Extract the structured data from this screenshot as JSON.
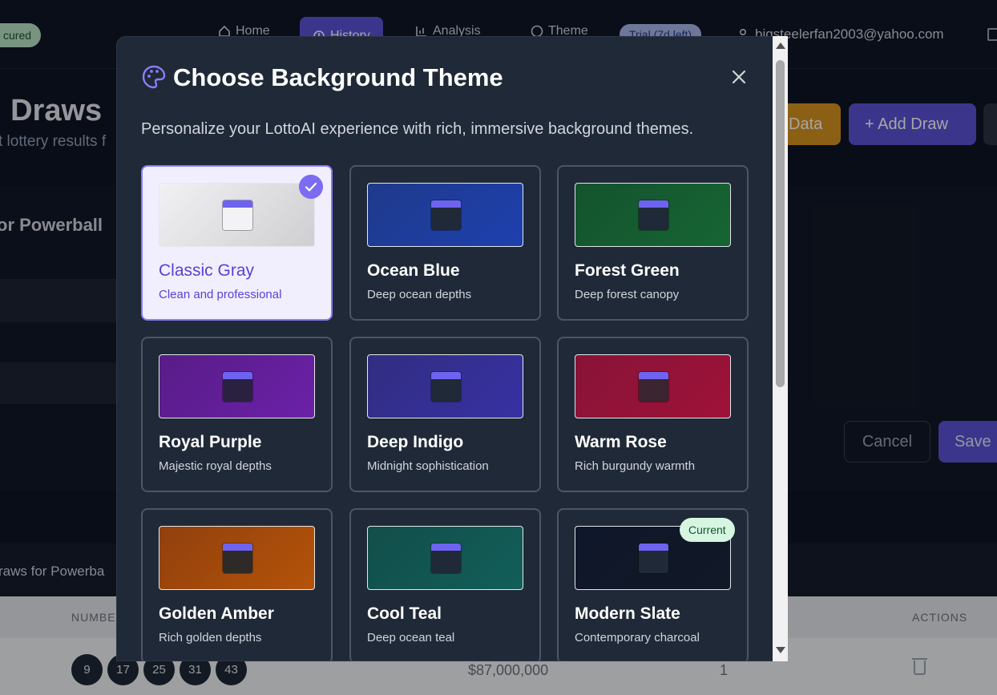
{
  "topnav": {
    "secured_label": "cured",
    "items": [
      {
        "label": "Home"
      },
      {
        "label": "History"
      },
      {
        "label": "Analysis"
      },
      {
        "label": "Theme"
      }
    ],
    "trial_label": "Trial (7d left)",
    "user_email": "bigsteelerfan2003@yahoo.com"
  },
  "page": {
    "title": "l Draws",
    "subtitle": "t lottery results f",
    "buttons": {
      "data_label": "Data",
      "add_draw_label": "+ Add Draw"
    },
    "panel_title": "or Powerball",
    "cancel_label": "Cancel",
    "save_label": "Save",
    "draws_label": "raws for Powerba"
  },
  "table": {
    "headers": {
      "numbers": "NUMBE",
      "actions": "ACTIONS"
    },
    "rows": [
      {
        "numbers": [
          "9",
          "17",
          "25",
          "31",
          "43"
        ],
        "jackpot": "$87,000,000",
        "multiplier": "1"
      }
    ]
  },
  "modal": {
    "title": "Choose Background Theme",
    "description": "Personalize your LottoAI experience with rich, immersive background themes.",
    "current_badge": "Current",
    "themes": [
      {
        "name": "Classic Gray",
        "desc": "Clean and professional",
        "selected": true,
        "colors": [
          "#f1f1f3",
          "#cfcfd2"
        ],
        "body": "#f3f3f5"
      },
      {
        "name": "Ocean Blue",
        "desc": "Deep ocean depths",
        "colors": [
          "#1e3a8a",
          "#1e40af"
        ],
        "body": "#1f2937"
      },
      {
        "name": "Forest Green",
        "desc": "Deep forest canopy",
        "colors": [
          "#14532d",
          "#166534"
        ],
        "body": "#1f2937"
      },
      {
        "name": "Royal Purple",
        "desc": "Majestic royal depths",
        "colors": [
          "#581c87",
          "#6b21a8"
        ],
        "body": "#2a2140"
      },
      {
        "name": "Deep Indigo",
        "desc": "Midnight sophistication",
        "colors": [
          "#312e81",
          "#3730a3"
        ],
        "body": "#1f2937"
      },
      {
        "name": "Warm Rose",
        "desc": "Rich burgundy warmth",
        "colors": [
          "#881337",
          "#9f1239"
        ],
        "body": "#3a2530"
      },
      {
        "name": "Golden Amber",
        "desc": "Rich golden depths",
        "colors": [
          "#92400e",
          "#b45309"
        ],
        "body": "#2d2a28"
      },
      {
        "name": "Cool Teal",
        "desc": "Deep ocean teal",
        "colors": [
          "#134e4a",
          "#115e59"
        ],
        "body": "#1f2937"
      },
      {
        "name": "Modern Slate",
        "desc": "Contemporary charcoal",
        "current": true,
        "colors": [
          "#0f172a",
          "#111827"
        ],
        "body": "#1f2937"
      }
    ]
  }
}
